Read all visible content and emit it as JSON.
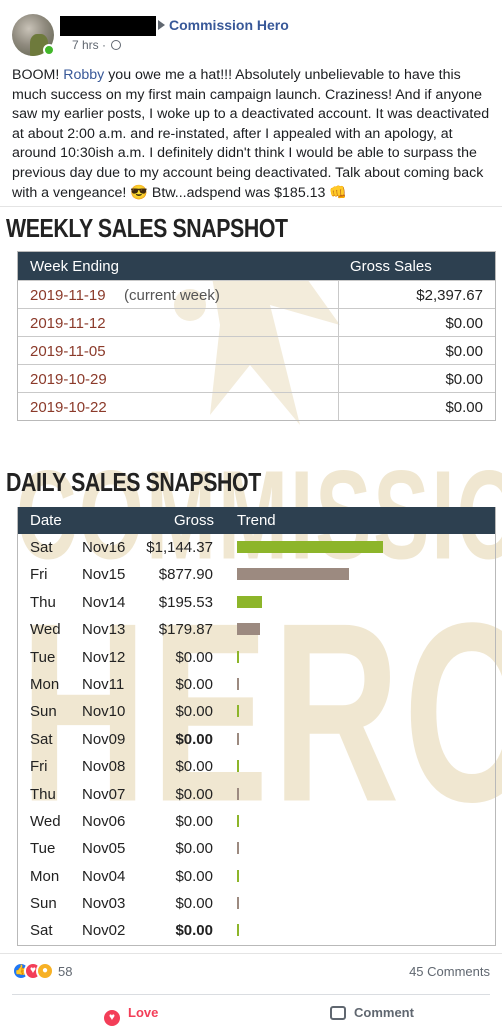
{
  "post": {
    "group_name": "Commission Hero",
    "time": "7 hrs",
    "separator": "·",
    "text_before_mention": "BOOM! ",
    "mention": "Robby",
    "text_after_mention": " you owe me a hat!!! Absolutely unbelievable to have this much success on my first main campaign launch. Craziness! And if anyone saw my earlier posts, I woke up to a deactivated account. It was deactivated at about 2:00 a.m. and re-instated, after I appealed with an apology, at around 10:30ish a.m. I definitely didn't think I would be able to surpass the previous day due to my account being deactivated. Talk about coming back with a vengeance! 😎 Btw...adspend was $185.13 👊"
  },
  "image": {
    "watermark_top": "COMMISSION",
    "watermark_bottom": "HERO",
    "weekly": {
      "title": "WEEKLY SALES SNAPSHOT",
      "headers": {
        "week": "Week Ending",
        "gross": "Gross Sales"
      },
      "rows": [
        {
          "date": "2019-11-19",
          "note": "(current week)",
          "amount": "$2,397.67"
        },
        {
          "date": "2019-11-12",
          "note": "",
          "amount": "$0.00"
        },
        {
          "date": "2019-11-05",
          "note": "",
          "amount": "$0.00"
        },
        {
          "date": "2019-10-29",
          "note": "",
          "amount": "$0.00"
        },
        {
          "date": "2019-10-22",
          "note": "",
          "amount": "$0.00"
        }
      ]
    },
    "daily": {
      "title": "DAILY SALES SNAPSHOT",
      "headers": {
        "date": "Date",
        "gross": "Gross",
        "trend": "Trend"
      },
      "colors": {
        "green": "#8db52a",
        "taupe": "#9c8a80"
      },
      "rows": [
        {
          "day": "Sat",
          "date": "Nov16",
          "gross": "$1,144.37",
          "bold": false,
          "trend": 1144.37,
          "color": "green"
        },
        {
          "day": "Fri",
          "date": "Nov15",
          "gross": "$877.90",
          "bold": false,
          "trend": 877.9,
          "color": "taupe"
        },
        {
          "day": "Thu",
          "date": "Nov14",
          "gross": "$195.53",
          "bold": false,
          "trend": 195.53,
          "color": "green"
        },
        {
          "day": "Wed",
          "date": "Nov13",
          "gross": "$179.87",
          "bold": false,
          "trend": 179.87,
          "color": "taupe"
        },
        {
          "day": "Tue",
          "date": "Nov12",
          "gross": "$0.00",
          "bold": false,
          "trend": 0,
          "color": "green"
        },
        {
          "day": "Mon",
          "date": "Nov11",
          "gross": "$0.00",
          "bold": false,
          "trend": 0,
          "color": "taupe"
        },
        {
          "day": "Sun",
          "date": "Nov10",
          "gross": "$0.00",
          "bold": false,
          "trend": 0,
          "color": "green"
        },
        {
          "day": "Sat",
          "date": "Nov09",
          "gross": "$0.00",
          "bold": true,
          "trend": 0,
          "color": "taupe"
        },
        {
          "day": "Fri",
          "date": "Nov08",
          "gross": "$0.00",
          "bold": false,
          "trend": 0,
          "color": "green"
        },
        {
          "day": "Thu",
          "date": "Nov07",
          "gross": "$0.00",
          "bold": false,
          "trend": 0,
          "color": "taupe"
        },
        {
          "day": "Wed",
          "date": "Nov06",
          "gross": "$0.00",
          "bold": false,
          "trend": 0,
          "color": "green"
        },
        {
          "day": "Tue",
          "date": "Nov05",
          "gross": "$0.00",
          "bold": false,
          "trend": 0,
          "color": "taupe"
        },
        {
          "day": "Mon",
          "date": "Nov04",
          "gross": "$0.00",
          "bold": false,
          "trend": 0,
          "color": "green"
        },
        {
          "day": "Sun",
          "date": "Nov03",
          "gross": "$0.00",
          "bold": false,
          "trend": 0,
          "color": "taupe"
        },
        {
          "day": "Sat",
          "date": "Nov02",
          "gross": "$0.00",
          "bold": true,
          "trend": 0,
          "color": "green"
        }
      ]
    }
  },
  "footer": {
    "reaction_count": "58",
    "comments": "45 Comments",
    "love_label": "Love",
    "comment_label": "Comment"
  }
}
